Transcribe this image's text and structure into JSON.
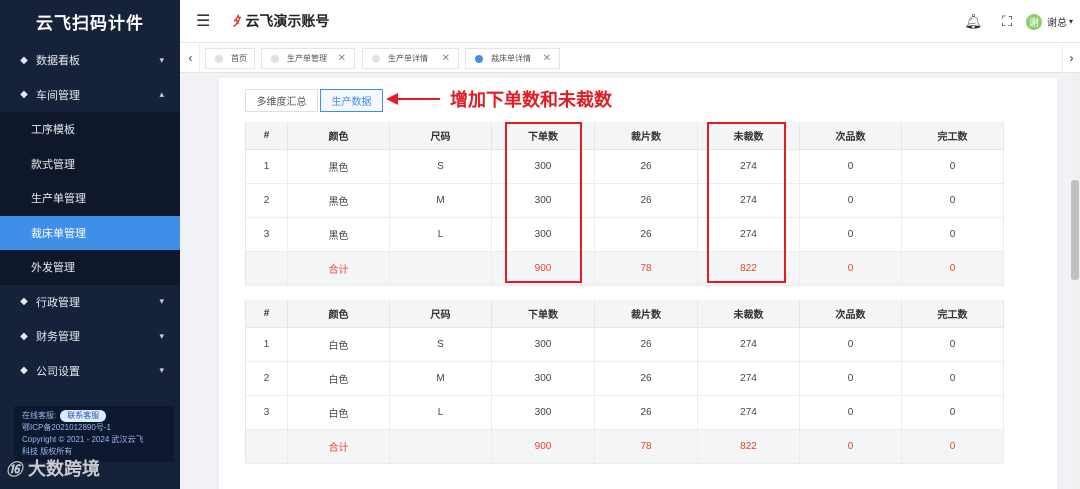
{
  "sidebar": {
    "brand": "云飞扫码计件",
    "menu": [
      {
        "label": "数据看板",
        "icon": "tag-icon",
        "arrow": "⌄"
      },
      {
        "label": "车间管理",
        "icon": "tag-icon",
        "arrow": "⌃"
      },
      {
        "label": "行政管理",
        "icon": "tag-icon",
        "arrow": "⌄"
      },
      {
        "label": "财务管理",
        "icon": "tag-icon",
        "arrow": "⌄"
      },
      {
        "label": "公司设置",
        "icon": "tag-icon",
        "arrow": "⌄"
      }
    ],
    "submenu": [
      {
        "label": "工序模板"
      },
      {
        "label": "款式管理"
      },
      {
        "label": "生产单管理"
      },
      {
        "label": "裁床单管理"
      },
      {
        "label": "外发管理"
      }
    ],
    "footer": {
      "online_label": "在线客服:",
      "contact_button": "联系客服",
      "icp": "鄂ICP备2021012890号-1",
      "copyright": "Copyright © 2021 - 2024 武汉云飞",
      "rights": "科技 版权所有"
    },
    "watermark": "大数跨境"
  },
  "header": {
    "account_name": "云飞演示账号",
    "user_name": "谢总",
    "avatar_initial": "谢"
  },
  "tabs": [
    {
      "label": "首页",
      "active": false,
      "closable": false
    },
    {
      "label": "生产单管理",
      "active": false,
      "closable": true
    },
    {
      "label": "生产单详情",
      "active": false,
      "closable": true
    },
    {
      "label": "裁床单详情",
      "active": true,
      "closable": true
    }
  ],
  "subtabs": [
    {
      "label": "多维度汇总",
      "active": false
    },
    {
      "label": "生产数据",
      "active": true
    }
  ],
  "annotation": "增加下单数和未裁数",
  "table": {
    "headers": [
      "#",
      "颜色",
      "尺码",
      "下单数",
      "裁片数",
      "未裁数",
      "次品数",
      "完工数"
    ],
    "groups": [
      {
        "rows": [
          [
            "1",
            "黑色",
            "S",
            "300",
            "26",
            "274",
            "0",
            "0"
          ],
          [
            "2",
            "黑色",
            "M",
            "300",
            "26",
            "274",
            "0",
            "0"
          ],
          [
            "3",
            "黑色",
            "L",
            "300",
            "26",
            "274",
            "0",
            "0"
          ]
        ],
        "total": [
          "",
          "合计",
          "",
          "900",
          "78",
          "822",
          "0",
          "0"
        ]
      },
      {
        "rows": [
          [
            "1",
            "白色",
            "S",
            "300",
            "26",
            "274",
            "0",
            "0"
          ],
          [
            "2",
            "白色",
            "M",
            "300",
            "26",
            "274",
            "0",
            "0"
          ],
          [
            "3",
            "白色",
            "L",
            "300",
            "26",
            "274",
            "0",
            "0"
          ]
        ],
        "total": [
          "",
          "合计",
          "",
          "900",
          "78",
          "822",
          "0",
          "0"
        ]
      }
    ]
  },
  "colors": {
    "sidebar_bg": "#16213a",
    "active_menu": "#3f8ee8",
    "highlight_red": "#e31b23",
    "total_text": "#e5452a"
  }
}
